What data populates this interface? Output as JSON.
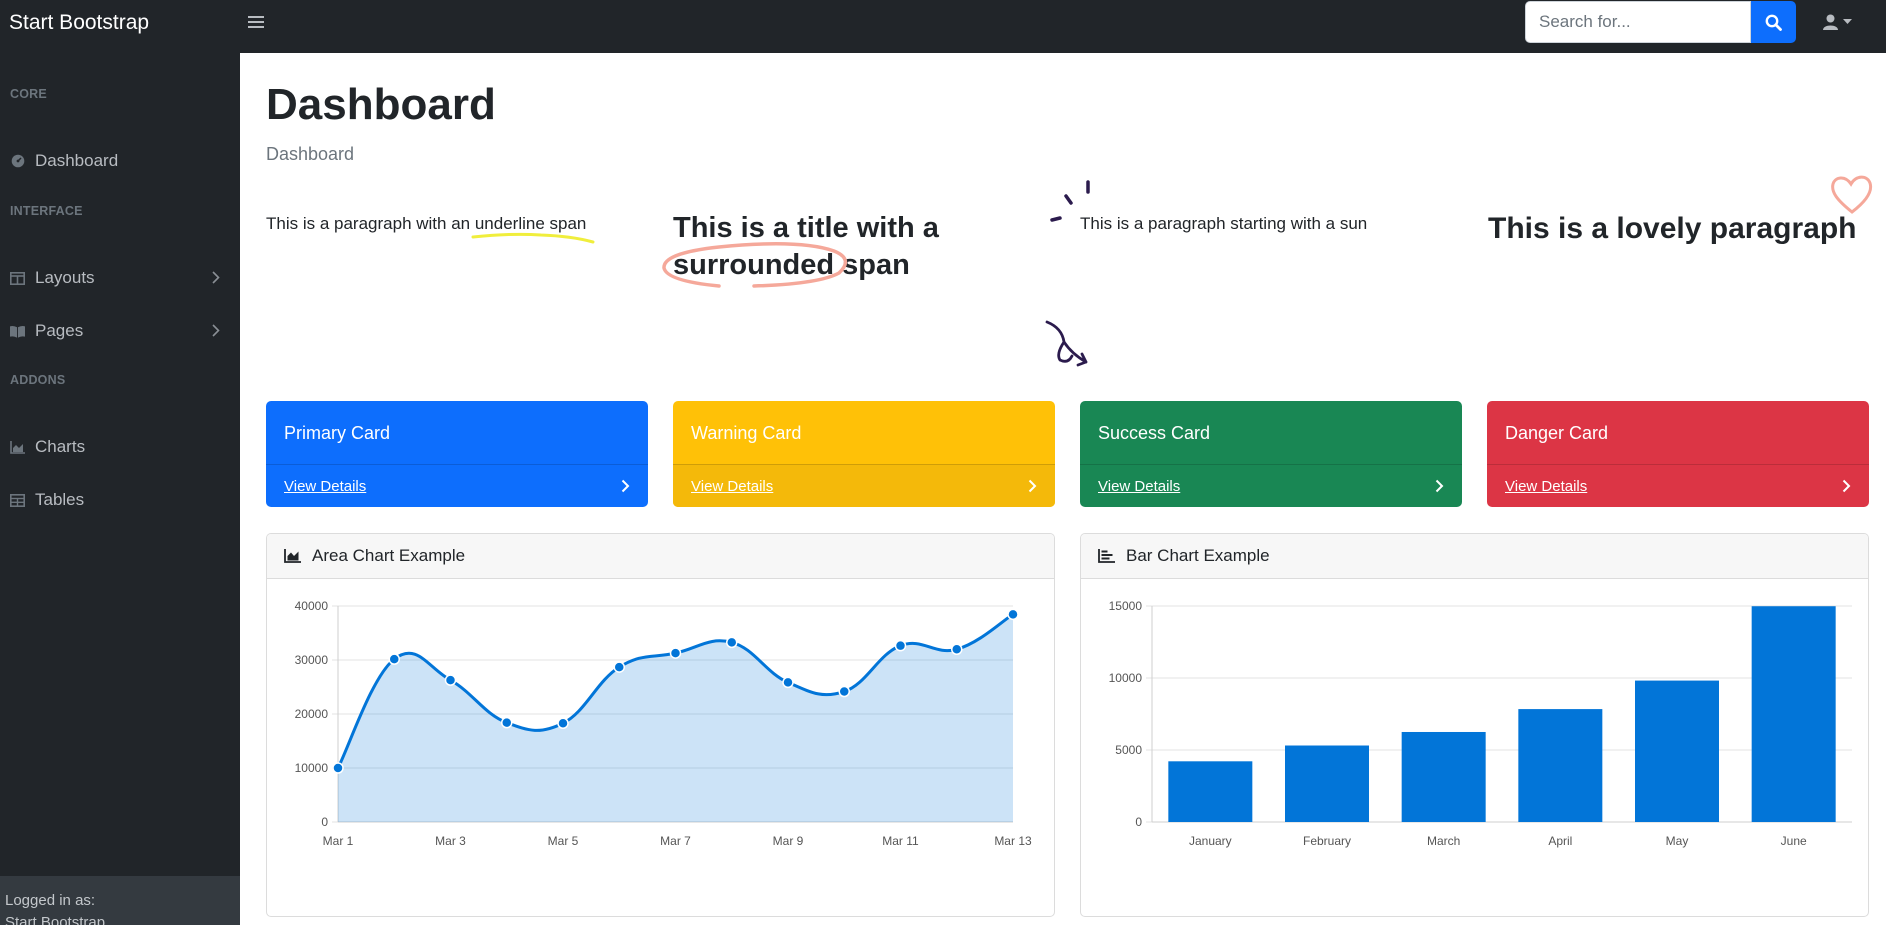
{
  "navbar": {
    "brand": "Start Bootstrap",
    "search_placeholder": "Search for..."
  },
  "sidebar": {
    "sections": [
      {
        "heading": "CORE",
        "items": [
          {
            "label": "Dashboard",
            "icon": "tachometer-icon"
          }
        ]
      },
      {
        "heading": "INTERFACE",
        "items": [
          {
            "label": "Layouts",
            "icon": "columns-icon"
          },
          {
            "label": "Pages",
            "icon": "book-open-icon"
          }
        ]
      },
      {
        "heading": "ADDONS",
        "items": [
          {
            "label": "Charts",
            "icon": "chart-area-icon"
          },
          {
            "label": "Tables",
            "icon": "table-icon"
          }
        ]
      }
    ],
    "footer": {
      "logged_in_label": "Logged in as:",
      "user": "Start Bootstrap"
    }
  },
  "main": {
    "title": "Dashboard",
    "breadcrumb": "Dashboard",
    "decor": {
      "p1_text": "This is a paragraph with an ",
      "p1_span": "underline span",
      "t2_text": "This is a title with a ",
      "t2_span": "surrounded",
      "t2_tail": " span",
      "p3_text": "This is a paragraph starting with a sun",
      "t4_text": "This is a lovely paragraph"
    },
    "cards": [
      {
        "title": "Primary Card",
        "link": "View Details",
        "color": "#0d6efd"
      },
      {
        "title": "Warning Card",
        "link": "View Details",
        "color": "#ffc107"
      },
      {
        "title": "Success Card",
        "link": "View Details",
        "color": "#198754"
      },
      {
        "title": "Danger Card",
        "link": "View Details",
        "color": "#dc3545"
      }
    ],
    "area_chart_title": "Area Chart Example",
    "bar_chart_title": "Bar Chart Example"
  },
  "chart_data": [
    {
      "type": "area",
      "title": "Area Chart Example",
      "x": [
        "Mar 1",
        "Mar 2",
        "Mar 3",
        "Mar 4",
        "Mar 5",
        "Mar 6",
        "Mar 7",
        "Mar 8",
        "Mar 9",
        "Mar 10",
        "Mar 11",
        "Mar 12",
        "Mar 13"
      ],
      "x_tick_labels": [
        "Mar 1",
        "Mar 3",
        "Mar 5",
        "Mar 7",
        "Mar 9",
        "Mar 11",
        "Mar 13"
      ],
      "values": [
        10000,
        30162,
        26263,
        18394,
        18287,
        28682,
        31274,
        33259,
        25849,
        24159,
        32651,
        31984,
        38451
      ],
      "ylim": [
        0,
        40000
      ],
      "y_ticks": [
        0,
        10000,
        20000,
        30000,
        40000
      ],
      "grid": true,
      "color": "#0275d8"
    },
    {
      "type": "bar",
      "title": "Bar Chart Example",
      "categories": [
        "January",
        "February",
        "March",
        "April",
        "May",
        "June"
      ],
      "values": [
        4215,
        5312,
        6251,
        7841,
        9821,
        14984
      ],
      "ylim": [
        0,
        15000
      ],
      "y_ticks": [
        0,
        5000,
        10000,
        15000
      ],
      "grid": true,
      "color": "#0275d8"
    }
  ]
}
